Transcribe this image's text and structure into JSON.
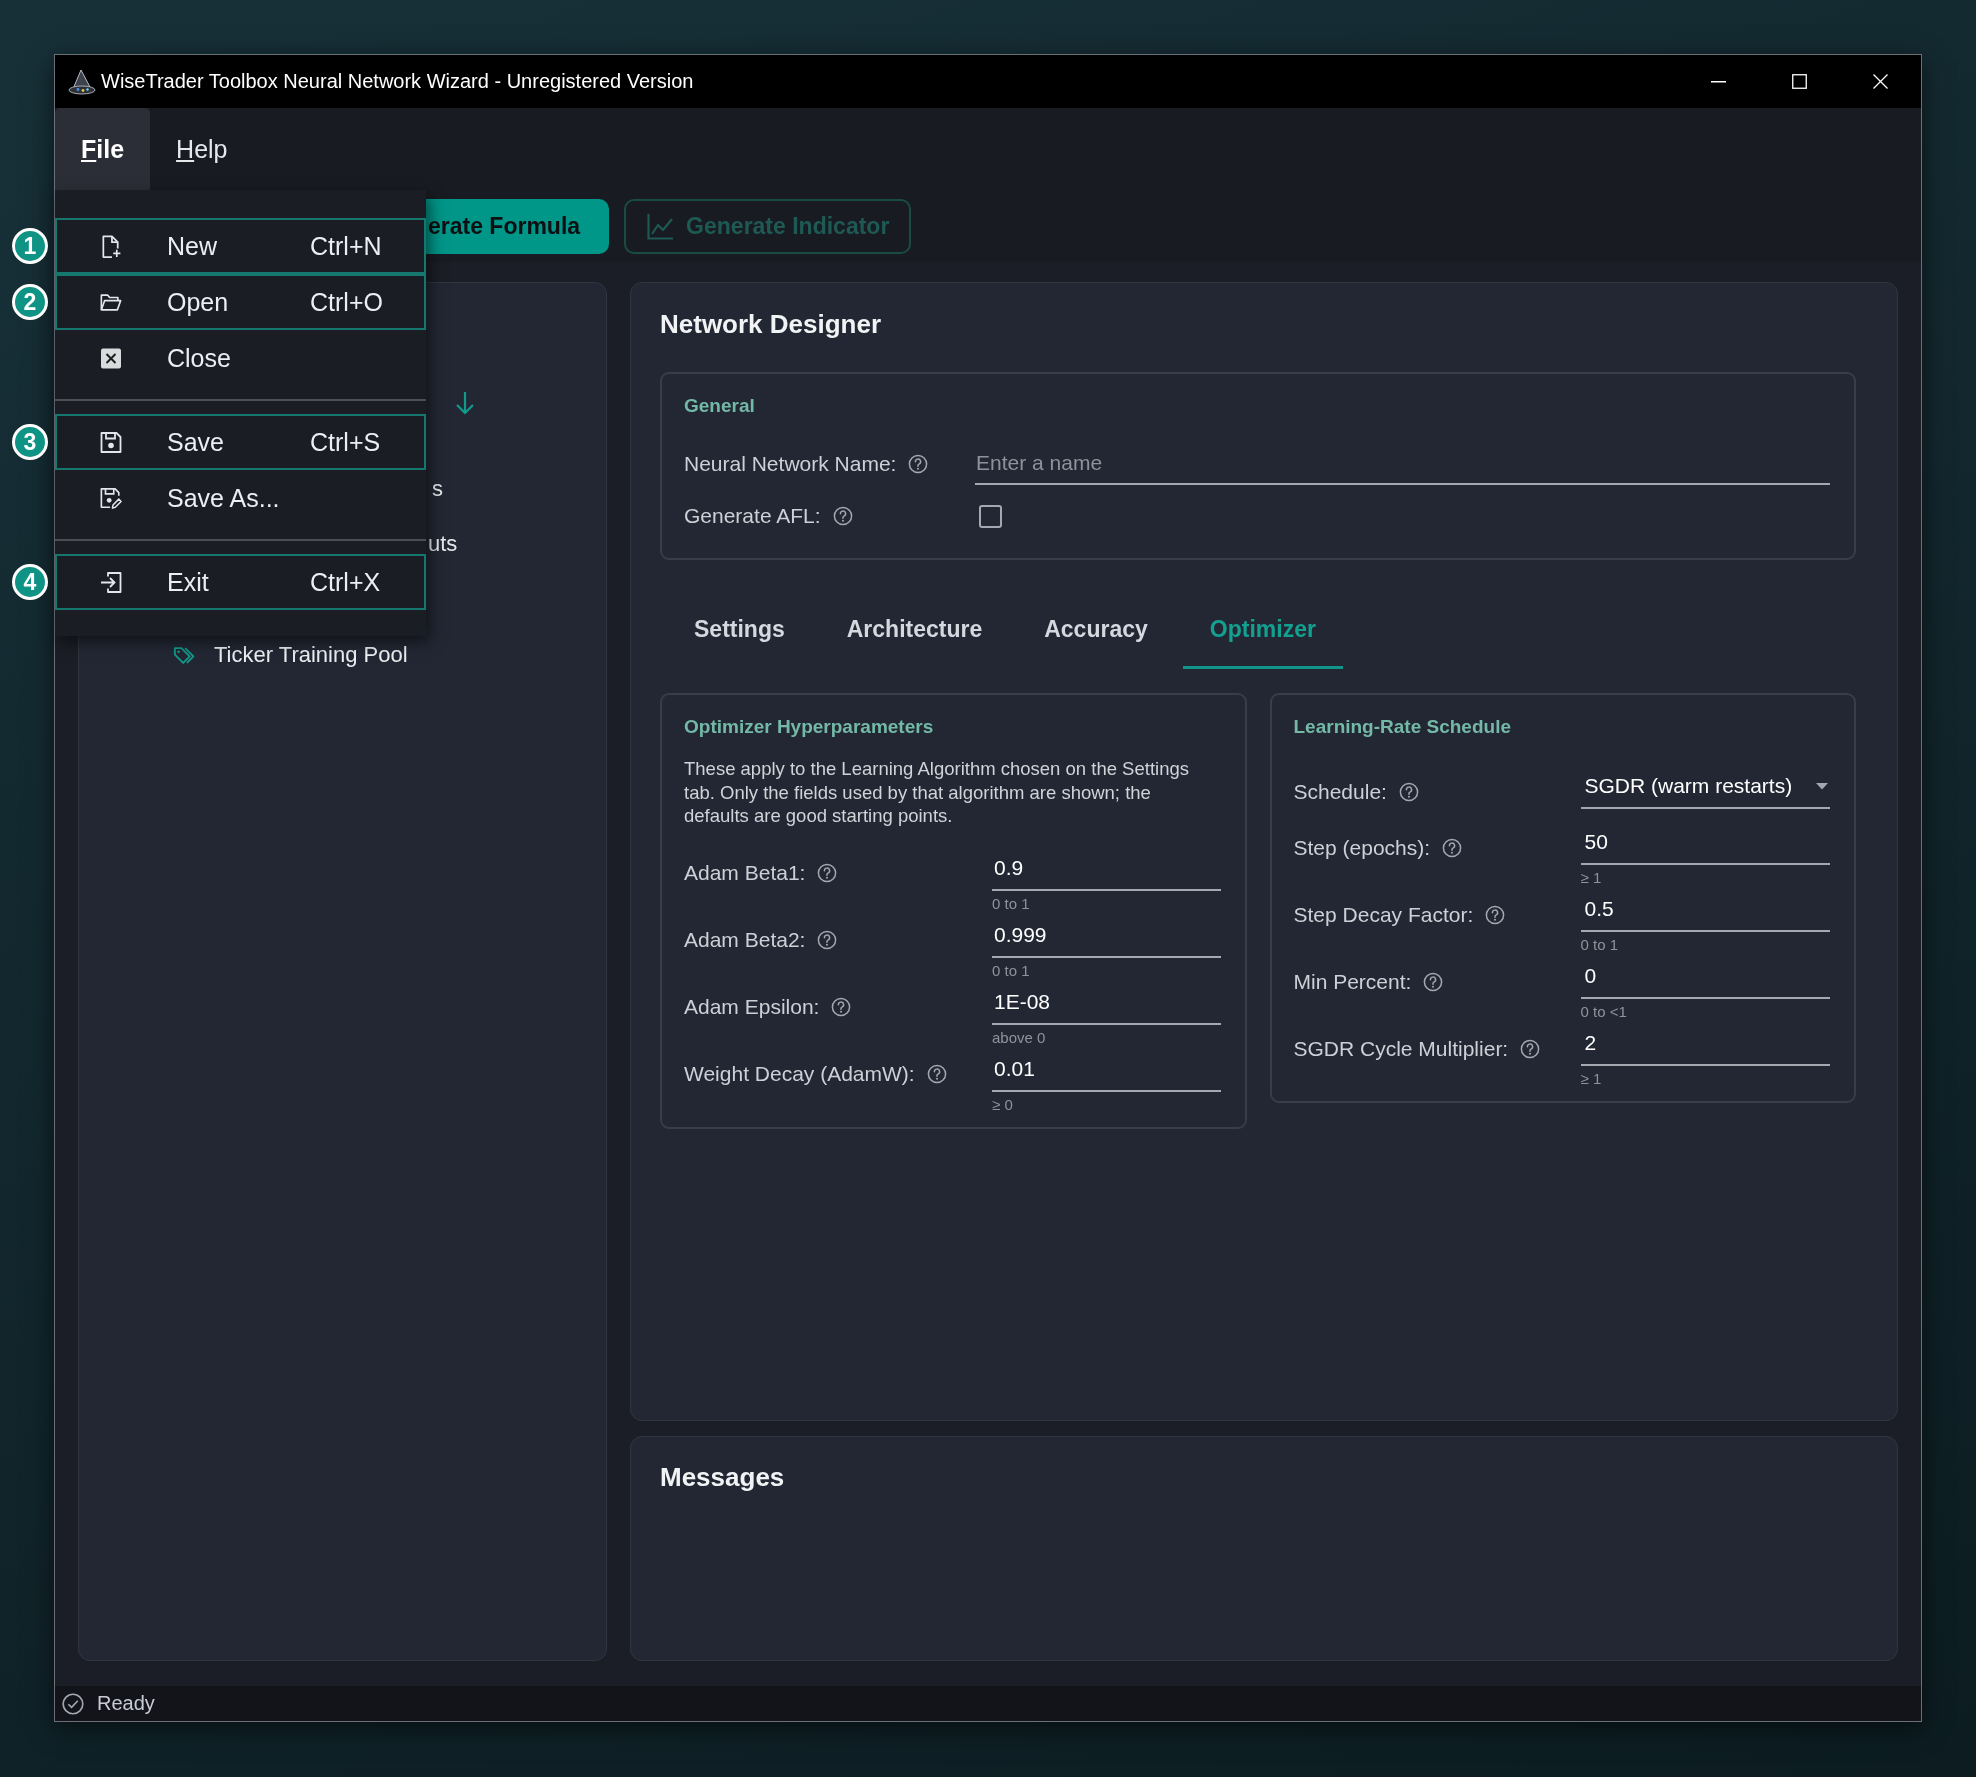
{
  "window": {
    "title": "WiseTrader Toolbox Neural Network Wizard - Unregistered Version"
  },
  "menubar": {
    "items": [
      {
        "label": "File",
        "selected": true
      },
      {
        "label": "Help",
        "selected": false
      }
    ]
  },
  "file_menu": {
    "items": [
      {
        "kind": "item",
        "label": "New",
        "shortcut": "Ctrl+N",
        "highlighted": true,
        "callout": "1"
      },
      {
        "kind": "item",
        "label": "Open",
        "shortcut": "Ctrl+O",
        "highlighted": true,
        "callout": "2"
      },
      {
        "kind": "item",
        "label": "Close",
        "highlighted": false
      },
      {
        "kind": "separator"
      },
      {
        "kind": "item",
        "label": "Save",
        "shortcut": "Ctrl+S",
        "highlighted": true,
        "callout": "3"
      },
      {
        "kind": "item",
        "label": "Save As...",
        "highlighted": false
      },
      {
        "kind": "separator"
      },
      {
        "kind": "item",
        "label": "Exit",
        "shortcut": "Ctrl+X",
        "highlighted": true,
        "callout": "4"
      }
    ]
  },
  "toolbar": {
    "buttons": [
      {
        "kind": "primary",
        "label": "erate Formula",
        "disabled": false
      },
      {
        "kind": "outline",
        "label": "Generate Indicator",
        "disabled": true
      }
    ]
  },
  "sidebar": {
    "fragments": [
      "s",
      "uts"
    ],
    "items": [
      {
        "label": "Ticker Training Pool"
      }
    ]
  },
  "designer": {
    "title": "Network Designer",
    "general": {
      "title": "General",
      "name_field": {
        "label": "Neural Network Name:",
        "placeholder": "Enter a name"
      },
      "afl": {
        "label": "Generate AFL:",
        "checked": false
      }
    },
    "tabs": [
      {
        "label": "Settings",
        "selected": false
      },
      {
        "label": "Architecture",
        "selected": false
      },
      {
        "label": "Accuracy",
        "selected": false
      },
      {
        "label": "Optimizer",
        "selected": true
      }
    ],
    "optimizer": {
      "title": "Optimizer Hyperparameters",
      "description": "These apply to the Learning Algorithm chosen on the Settings tab. Only the fields used by that algorithm are shown; the defaults are good starting points.",
      "fields": [
        {
          "label": "Adam Beta1:",
          "value": "0.9",
          "hint": "0 to 1"
        },
        {
          "label": "Adam Beta2:",
          "value": "0.999",
          "hint": "0 to 1"
        },
        {
          "label": "Adam Epsilon:",
          "value": "1E-08",
          "hint": "above 0"
        },
        {
          "label": "Weight Decay (AdamW):",
          "value": "0.01",
          "hint": "≥ 0"
        }
      ]
    },
    "schedule": {
      "title": "Learning-Rate Schedule",
      "fields": [
        {
          "kind": "select",
          "label": "Schedule:",
          "value": "SGDR (warm restarts)"
        },
        {
          "kind": "input",
          "label": "Step (epochs):",
          "value": "50",
          "hint": "≥ 1"
        },
        {
          "kind": "input",
          "label": "Step Decay Factor:",
          "value": "0.5",
          "hint": "0 to 1"
        },
        {
          "kind": "input",
          "label": "Min Percent:",
          "value": "0",
          "hint": "0 to <1"
        },
        {
          "kind": "input",
          "label": "SGDR Cycle Multiplier:",
          "value": "2",
          "hint": "≥ 1"
        }
      ]
    }
  },
  "messages": {
    "title": "Messages"
  },
  "status_bar": {
    "text": "Ready"
  }
}
